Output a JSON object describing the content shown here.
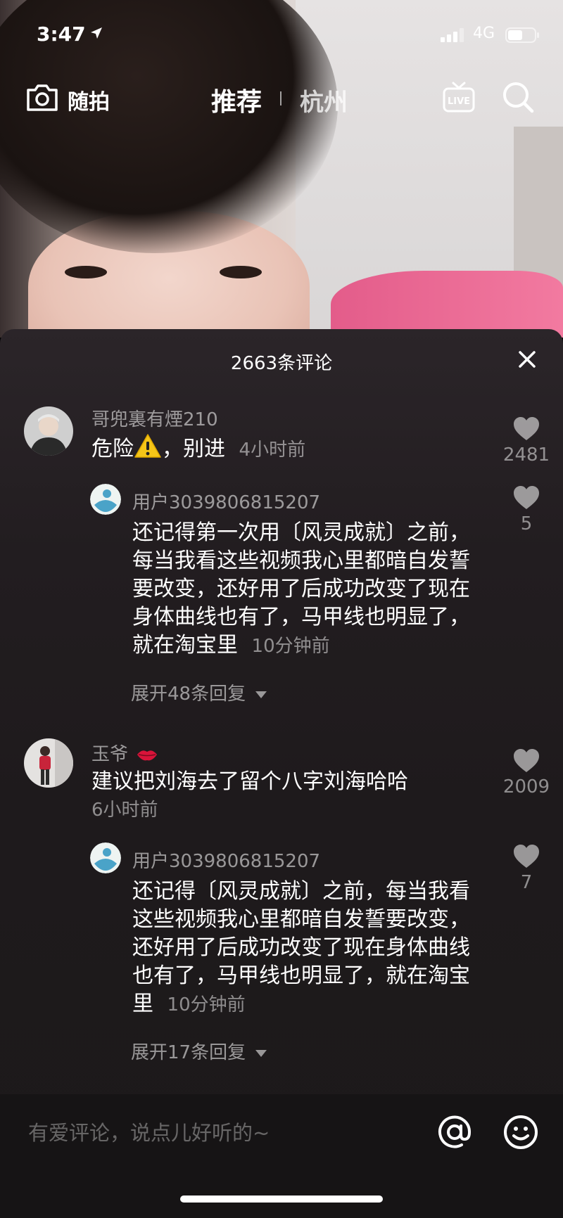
{
  "status_bar": {
    "time": "3:47",
    "network": "4G"
  },
  "top_nav": {
    "shoot_label": "随拍",
    "recommend_label": "推荐",
    "city_label": "杭州",
    "live_badge": "LIVE"
  },
  "comments_panel": {
    "title": "2663条评论",
    "comments": [
      {
        "username": "哥兜裏有煙210",
        "text": "危险",
        "text_after_icon": "，别进",
        "time": "4小时前",
        "likes": "2481",
        "reply": {
          "username": "用户3039806815207",
          "text": "还记得第一次用〔风灵成就〕之前，每当我看这些视频我心里都暗自发誓要改变，还好用了后成功改变了现在身体曲线也有了，马甲线也明显了，就在淘宝里",
          "time": "10分钟前",
          "likes": "5"
        },
        "expand_label": "展开48条回复"
      },
      {
        "username": "玉爷",
        "text": "建议把刘海去了留个八字刘海哈哈",
        "time": "6小时前",
        "likes": "2009",
        "reply": {
          "username": "用户3039806815207",
          "text": "还记得〔风灵成就〕之前，每当我看这些视频我心里都暗自发誓要改变，还好用了后成功改变了现在身体曲线也有了，马甲线也明显了，就在淘宝里",
          "time": "10分钟前",
          "likes": "7"
        },
        "expand_label": "展开17条回复"
      }
    ]
  },
  "input": {
    "placeholder": "有爱评论，说点儿好听的~"
  },
  "icons": {
    "camera": "camera-icon",
    "live": "live-tv-icon",
    "search": "search-icon",
    "close": "close-icon",
    "heart": "heart-icon",
    "at": "at-icon",
    "emoji": "emoji-icon",
    "warning": "warning-icon",
    "lips": "lips-icon"
  },
  "colors": {
    "sheet_bg": "#221d20",
    "muted_text": "#8a8588",
    "input_bg": "#161415",
    "warning": "#f5c518",
    "lips": "#d9143a"
  }
}
